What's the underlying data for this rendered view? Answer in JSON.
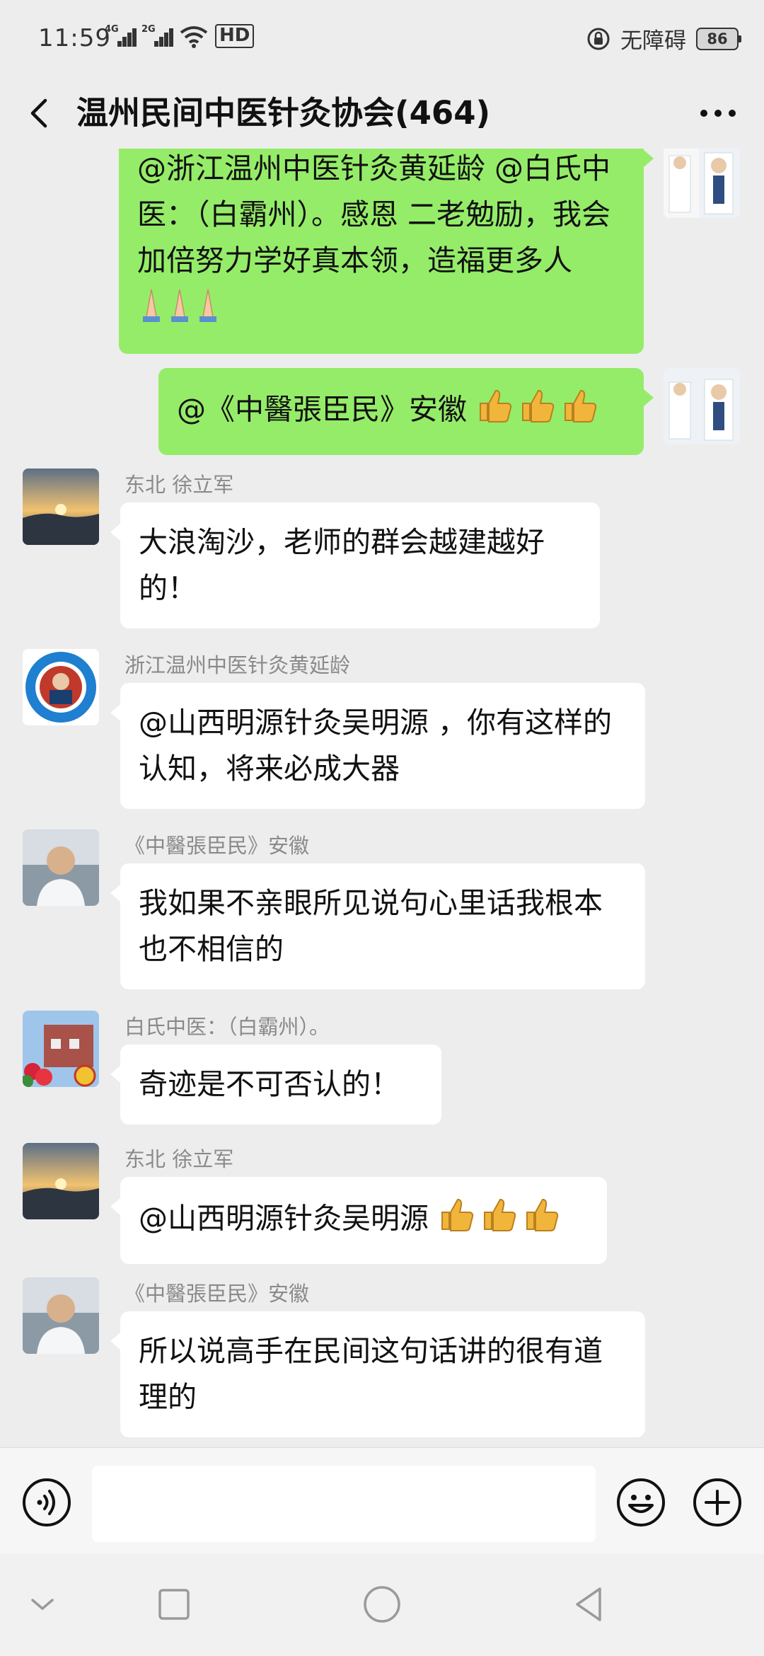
{
  "status_bar": {
    "time": "11:59",
    "sim1_label": "4G",
    "sim2_label": "2G",
    "hd_label": "HD",
    "accessibility_label": "无障碍",
    "battery": "86"
  },
  "nav": {
    "title": "温州民间中医针灸协会(464)"
  },
  "messages": [
    {
      "id": "m1",
      "side": "out",
      "text": "@浙江温州中医针灸黄延龄 @白氏中医：（白霸州）。感恩  二老勉励，我会加倍努力学好真本领，造福更多人",
      "emoji": "folded-hands",
      "emoji_count": 3
    },
    {
      "id": "m2",
      "side": "out",
      "text": "@《中醫張臣民》安徽 ",
      "emoji": "thumbs-up",
      "emoji_count": 3
    },
    {
      "id": "m3",
      "side": "in",
      "sender": "东北   徐立军",
      "text": "大浪淘沙，老师的群会越建越好的！"
    },
    {
      "id": "m4",
      "side": "in",
      "sender": "浙江温州中医针灸黄延龄",
      "text": "@山西明源针灸吴明源 ，你有这样的认知，将来必成大器"
    },
    {
      "id": "m5",
      "side": "in",
      "sender": "《中醫張臣民》安徽",
      "text": "我如果不亲眼所见说句心里话我根本也不相信的"
    },
    {
      "id": "m6",
      "side": "in",
      "sender": "白氏中医：（白霸州）。",
      "text": "奇迹是不可否认的！"
    },
    {
      "id": "m7",
      "side": "in",
      "sender": "东北   徐立军",
      "text": "@山西明源针灸吴明源 ",
      "emoji": "thumbs-up",
      "emoji_count": 3
    },
    {
      "id": "m8",
      "side": "in",
      "sender": "《中醫張臣民》安徽",
      "text": "所以说高手在民间这句话讲的很有道理的"
    }
  ],
  "input": {
    "voice_icon": "voice-icon",
    "emoji_icon": "emoji-icon",
    "plus_icon": "plus-icon",
    "value": ""
  },
  "colors": {
    "background": "#ededed",
    "bubble_out": "#95ec69",
    "bubble_in": "#ffffff",
    "sender_text": "#8a8a8a"
  },
  "system_nav": [
    "chevron-down-icon",
    "recents-icon",
    "home-icon",
    "back-icon"
  ]
}
